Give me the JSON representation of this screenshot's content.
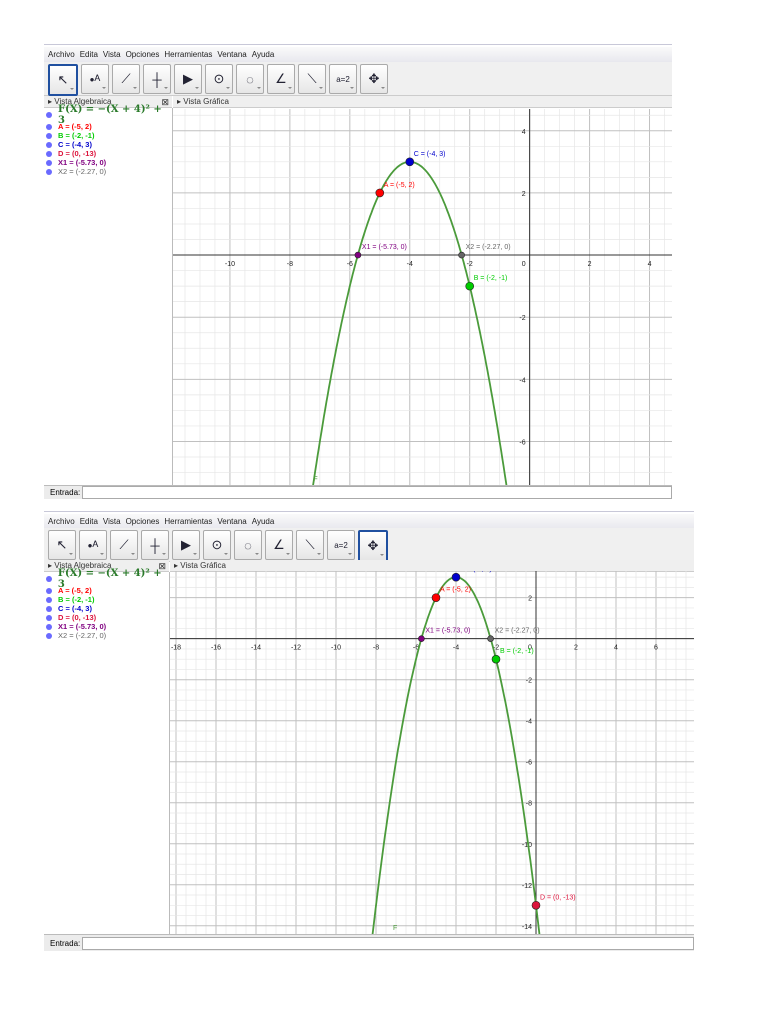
{
  "menu": [
    "Archivo",
    "Edita",
    "Vista",
    "Opciones",
    "Herramientas",
    "Ventana",
    "Ayuda"
  ],
  "tools": [
    {
      "name": "move-tool",
      "glyph": "↖"
    },
    {
      "name": "point-tool",
      "glyph": "•ᴬ"
    },
    {
      "name": "line-tool",
      "glyph": "⟋"
    },
    {
      "name": "perpendicular-tool",
      "glyph": "┼"
    },
    {
      "name": "polygon-tool",
      "glyph": "▶"
    },
    {
      "name": "circle-tool",
      "glyph": "⊙"
    },
    {
      "name": "conic-tool",
      "glyph": "◌"
    },
    {
      "name": "angle-tool",
      "glyph": "∠"
    },
    {
      "name": "reflect-tool",
      "glyph": "⟍"
    },
    {
      "name": "slider-tool",
      "glyph": "a=2"
    },
    {
      "name": "move-view-tool",
      "glyph": "✥"
    }
  ],
  "algebra_header": "Vista Algebraica",
  "graphics_header": "Vista Gráfica",
  "entrada_label": "Entrada:",
  "function_text": "F(X) = −(X + 4)² + 3",
  "curve_label": "F",
  "colors": {
    "curve": "#4b9b3b",
    "A": "#ff0000",
    "B": "#00cc00",
    "C": "#0000cc",
    "D": "#dc143c",
    "X1": "#800080",
    "X2": "#666666"
  },
  "objects": [
    {
      "id": "A",
      "text": "A = (-5, 2)",
      "x": -5,
      "y": 2
    },
    {
      "id": "B",
      "text": "B = (-2, -1)",
      "x": -2,
      "y": -1
    },
    {
      "id": "C",
      "text": "C = (-4, 3)",
      "x": -4,
      "y": 3
    },
    {
      "id": "D",
      "text": "D = (0, -13)",
      "x": 0,
      "y": -13
    },
    {
      "id": "X1",
      "text": "X1 = (-5.73, 0)",
      "x": -5.73,
      "y": 0
    },
    {
      "id": "X2",
      "text": "X2 = (-2.27, 0)",
      "x": -2.27,
      "y": 0
    }
  ],
  "windows": [
    {
      "selected_tool": 0,
      "xlim": [
        -11.9,
        4.75
      ],
      "ylim": [
        -7.4,
        4.7
      ]
    },
    {
      "selected_tool": 10,
      "xlim": [
        -18.3,
        7.9
      ],
      "ylim": [
        -14.4,
        3.3
      ]
    }
  ]
}
